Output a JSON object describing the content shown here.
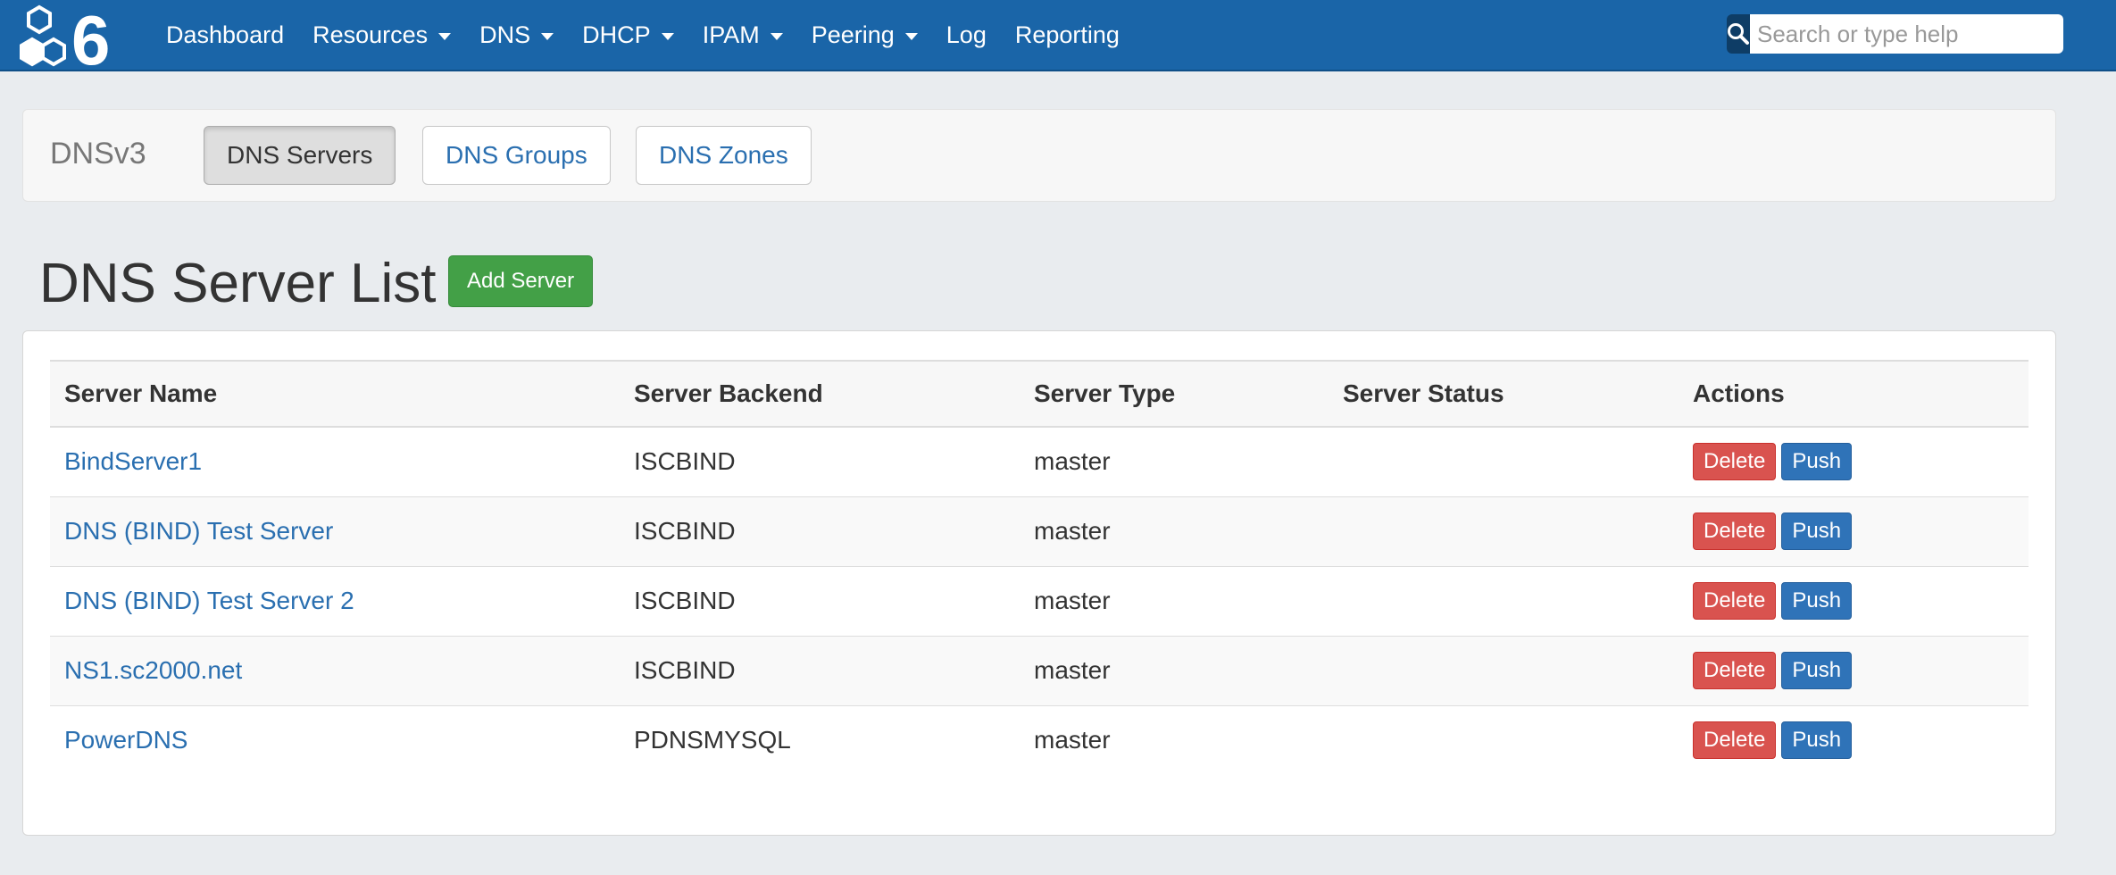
{
  "colors": {
    "navbar": "#1a65a8",
    "link": "#2a6fb0",
    "add_button": "#43a047",
    "delete_button": "#d9534f",
    "push_button": "#2f73b8"
  },
  "navbar": {
    "logo_icon": "hexagon-6-logo-icon",
    "items": [
      {
        "label": "Dashboard",
        "dropdown": false
      },
      {
        "label": "Resources",
        "dropdown": true
      },
      {
        "label": "DNS",
        "dropdown": true
      },
      {
        "label": "DHCP",
        "dropdown": true
      },
      {
        "label": "IPAM",
        "dropdown": true
      },
      {
        "label": "Peering",
        "dropdown": true
      },
      {
        "label": "Log",
        "dropdown": false
      },
      {
        "label": "Reporting",
        "dropdown": false
      }
    ],
    "search": {
      "icon": "search-icon",
      "placeholder": "Search or type help",
      "value": ""
    }
  },
  "subnav": {
    "brand": "DNSv3",
    "tabs": [
      {
        "label": "DNS Servers",
        "active": true
      },
      {
        "label": "DNS Groups",
        "active": false
      },
      {
        "label": "DNS Zones",
        "active": false
      }
    ]
  },
  "page": {
    "title": "DNS Server List",
    "add_button_label": "Add Server"
  },
  "table": {
    "headers": [
      "Server Name",
      "Server Backend",
      "Server Type",
      "Server Status",
      "Actions"
    ],
    "action_labels": {
      "delete": "Delete",
      "push": "Push"
    },
    "rows": [
      {
        "name": "BindServer1",
        "backend": "ISCBIND",
        "type": "master",
        "status": ""
      },
      {
        "name": "DNS (BIND) Test Server",
        "backend": "ISCBIND",
        "type": "master",
        "status": ""
      },
      {
        "name": "DNS (BIND) Test Server 2",
        "backend": "ISCBIND",
        "type": "master",
        "status": ""
      },
      {
        "name": "NS1.sc2000.net",
        "backend": "ISCBIND",
        "type": "master",
        "status": ""
      },
      {
        "name": "PowerDNS",
        "backend": "PDNSMYSQL",
        "type": "master",
        "status": ""
      }
    ]
  }
}
